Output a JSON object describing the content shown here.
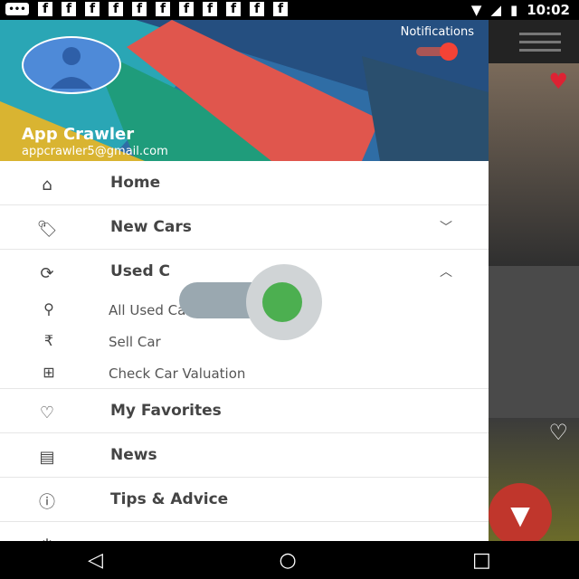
{
  "status_bar": {
    "time": "10:02",
    "notif_glyphs": [
      "f",
      "f",
      "f",
      "f",
      "f",
      "f",
      "f",
      "f",
      "f",
      "f",
      "f"
    ],
    "icons": [
      "message-icon",
      "wifi-icon",
      "signal-icon",
      "battery-icon"
    ]
  },
  "drawer_header": {
    "notifications_label": "Notifications",
    "user_name": "App Crawler",
    "user_email": "appcrawler5@gmail.com"
  },
  "menu": {
    "home": "Home",
    "new_cars": "New Cars",
    "used_cars": "Used C",
    "sub_items": [
      {
        "label": "All Used Cars"
      },
      {
        "label": "Sell Car"
      },
      {
        "label": "Check Car Valuation"
      }
    ],
    "my_favorites": "My Favorites",
    "news": "News",
    "tips": "Tips & Advice"
  },
  "colors": {
    "accent_red": "#f44336",
    "fab_red": "#c0362c",
    "toggle_green": "#4caf50"
  }
}
